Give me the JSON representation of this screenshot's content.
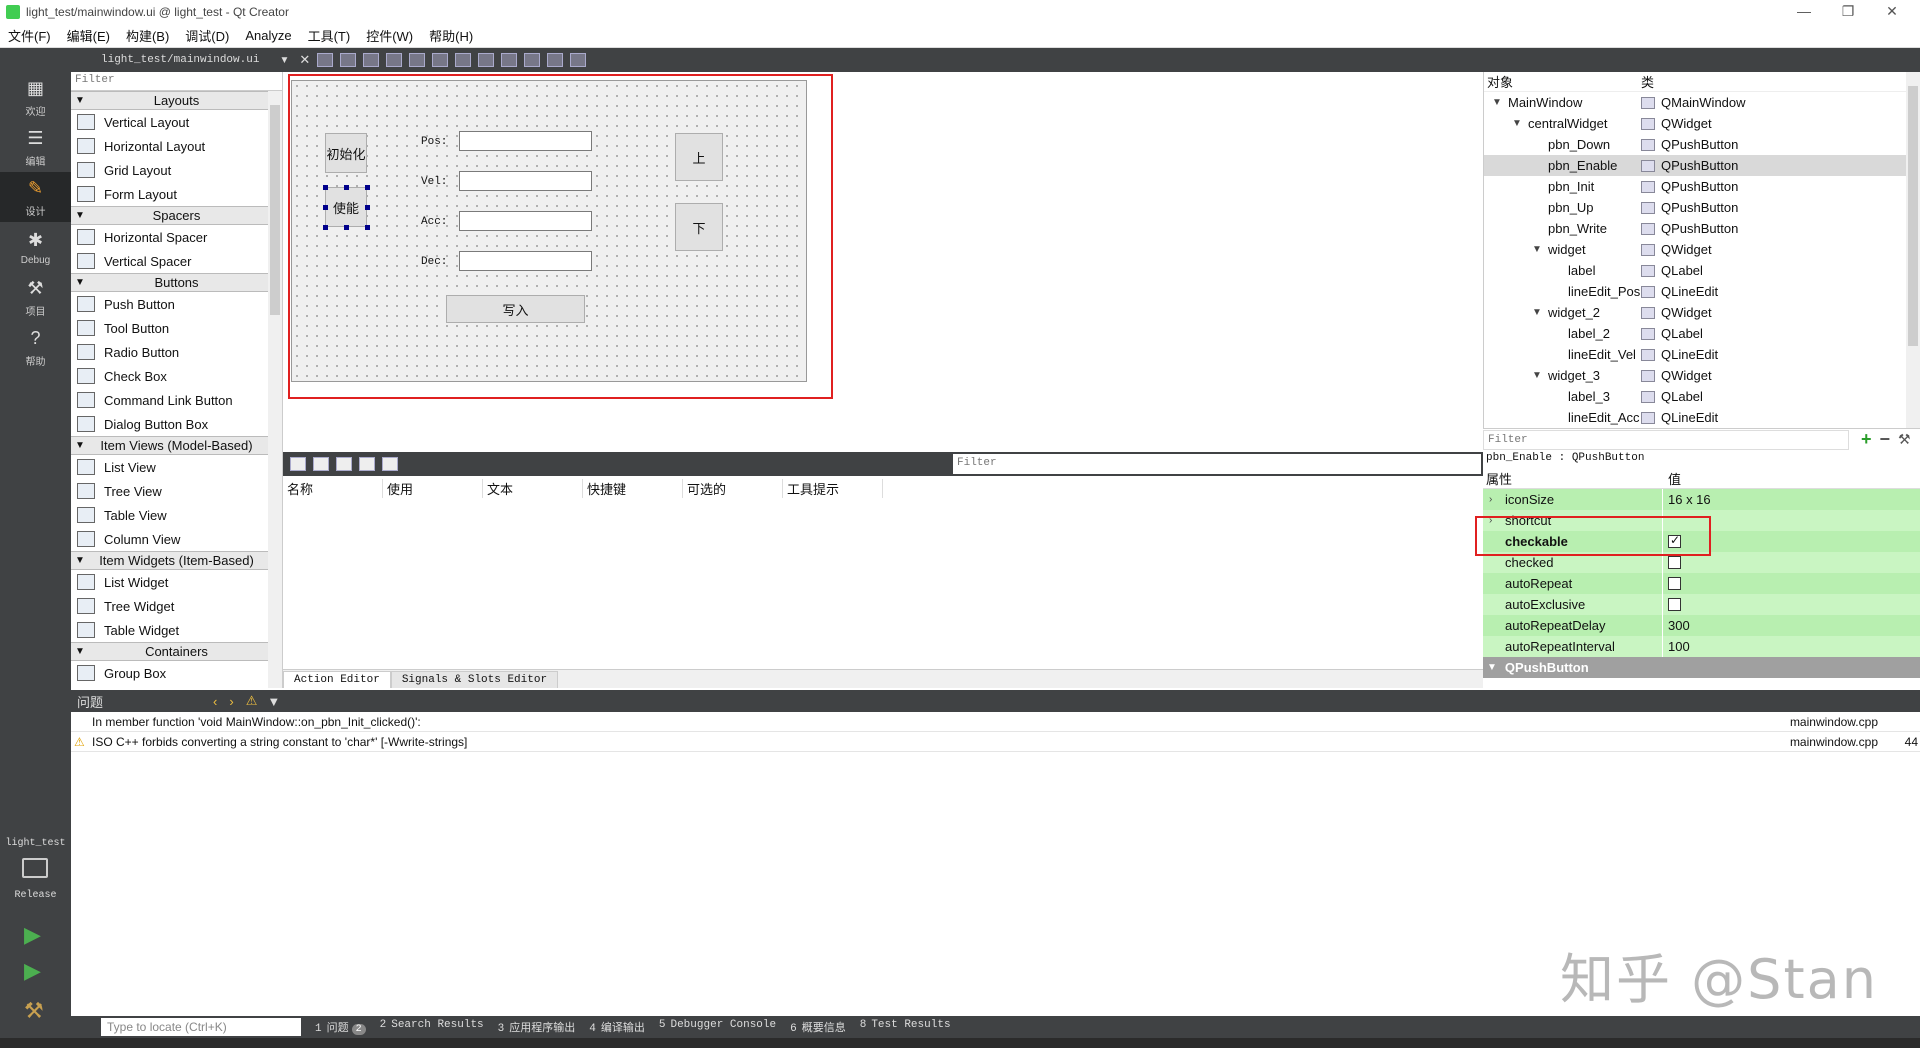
{
  "window": {
    "title": "light_test/mainwindow.ui @ light_test - Qt Creator"
  },
  "menu": [
    "文件(F)",
    "编辑(E)",
    "构建(B)",
    "调试(D)",
    "Analyze",
    "工具(T)",
    "控件(W)",
    "帮助(H)"
  ],
  "modes": [
    {
      "label": "欢迎",
      "icon": "grid-icon"
    },
    {
      "label": "编辑",
      "icon": "document-icon"
    },
    {
      "label": "设计",
      "icon": "pencil-icon"
    },
    {
      "label": "Debug",
      "icon": "bug-icon"
    },
    {
      "label": "项目",
      "icon": "wrench-icon"
    },
    {
      "label": "帮助",
      "icon": "help-icon"
    }
  ],
  "kit": {
    "project": "light_test",
    "config": "Release"
  },
  "toolbar": {
    "file": "light_test/mainwindow.ui"
  },
  "widgetbox": {
    "filter": "Filter",
    "sections": [
      {
        "title": "Layouts",
        "items": [
          "Vertical Layout",
          "Horizontal Layout",
          "Grid Layout",
          "Form Layout"
        ]
      },
      {
        "title": "Spacers",
        "items": [
          "Horizontal Spacer",
          "Vertical Spacer"
        ]
      },
      {
        "title": "Buttons",
        "items": [
          "Push Button",
          "Tool Button",
          "Radio Button",
          "Check Box",
          "Command Link Button",
          "Dialog Button Box"
        ]
      },
      {
        "title": "Item Views (Model-Based)",
        "items": [
          "List View",
          "Tree View",
          "Table View",
          "Column View"
        ]
      },
      {
        "title": "Item Widgets (Item-Based)",
        "items": [
          "List Widget",
          "Tree Widget",
          "Table Widget"
        ]
      },
      {
        "title": "Containers",
        "items": [
          "Group Box"
        ]
      }
    ]
  },
  "form": {
    "btn_init": "初始化",
    "btn_enable": "使能",
    "btn_up": "上",
    "btn_down": "下",
    "btn_write": "写入",
    "labels": [
      "Pos:",
      "Vel:",
      "Acc:",
      "Dec:"
    ]
  },
  "action_editor": {
    "filter": "Filter",
    "columns": [
      "名称",
      "使用",
      "文本",
      "快捷键",
      "可选的",
      "工具提示"
    ],
    "tabs": [
      "Action Editor",
      "Signals & Slots Editor"
    ]
  },
  "object_inspector": {
    "headers": [
      "对象",
      "类"
    ],
    "rows": [
      {
        "name": "MainWindow",
        "cls": "QMainWindow",
        "depth": 0,
        "exp": "v"
      },
      {
        "name": "centralWidget",
        "cls": "QWidget",
        "depth": 1,
        "exp": "v"
      },
      {
        "name": "pbn_Down",
        "cls": "QPushButton",
        "depth": 2,
        "exp": ""
      },
      {
        "name": "pbn_Enable",
        "cls": "QPushButton",
        "depth": 2,
        "exp": "",
        "selected": true
      },
      {
        "name": "pbn_Init",
        "cls": "QPushButton",
        "depth": 2,
        "exp": ""
      },
      {
        "name": "pbn_Up",
        "cls": "QPushButton",
        "depth": 2,
        "exp": ""
      },
      {
        "name": "pbn_Write",
        "cls": "QPushButton",
        "depth": 2,
        "exp": ""
      },
      {
        "name": "widget",
        "cls": "QWidget",
        "depth": 2,
        "exp": "v"
      },
      {
        "name": "label",
        "cls": "QLabel",
        "depth": 3,
        "exp": ""
      },
      {
        "name": "lineEdit_Pos",
        "cls": "QLineEdit",
        "depth": 3,
        "exp": ""
      },
      {
        "name": "widget_2",
        "cls": "QWidget",
        "depth": 2,
        "exp": "v"
      },
      {
        "name": "label_2",
        "cls": "QLabel",
        "depth": 3,
        "exp": ""
      },
      {
        "name": "lineEdit_Vel",
        "cls": "QLineEdit",
        "depth": 3,
        "exp": ""
      },
      {
        "name": "widget_3",
        "cls": "QWidget",
        "depth": 2,
        "exp": "v"
      },
      {
        "name": "label_3",
        "cls": "QLabel",
        "depth": 3,
        "exp": ""
      },
      {
        "name": "lineEdit_Acc",
        "cls": "QLineEdit",
        "depth": 3,
        "exp": ""
      }
    ]
  },
  "property_editor": {
    "filter": "Filter",
    "object_class": "pbn_Enable : QPushButton",
    "headers": [
      "属性",
      "值"
    ],
    "rows": [
      {
        "name": "iconSize",
        "value": "16 x 16",
        "expand": ">",
        "bold": false,
        "style": "g"
      },
      {
        "name": "shortcut",
        "value": "",
        "expand": ">",
        "bold": false,
        "style": "g2"
      },
      {
        "name": "checkable",
        "value": "",
        "checkbox": true,
        "checked": true,
        "bold": true,
        "style": "g"
      },
      {
        "name": "checked",
        "value": "",
        "checkbox": true,
        "checked": false,
        "bold": false,
        "style": "g2"
      },
      {
        "name": "autoRepeat",
        "value": "",
        "checkbox": true,
        "checked": false,
        "bold": false,
        "style": "g"
      },
      {
        "name": "autoExclusive",
        "value": "",
        "checkbox": true,
        "checked": false,
        "bold": false,
        "style": "g2"
      },
      {
        "name": "autoRepeatDelay",
        "value": "300",
        "bold": false,
        "style": "g"
      },
      {
        "name": "autoRepeatInterval",
        "value": "100",
        "bold": false,
        "style": "g2"
      }
    ],
    "section": "QPushButton"
  },
  "issues": {
    "title": "问题",
    "rows": [
      {
        "text": "In member function 'void MainWindow::on_pbn_Init_clicked()':",
        "file": "mainwindow.cpp",
        "line": "",
        "warn": false
      },
      {
        "text": "ISO C++ forbids converting a string constant to 'char*' [-Wwrite-strings]",
        "file": "mainwindow.cpp",
        "line": "44",
        "warn": true
      }
    ]
  },
  "watermark": "知乎 @Stan",
  "statusbar": {
    "locate_placeholder": "Type to locate (Ctrl+K)",
    "tabs": [
      {
        "num": "1",
        "label": "问题",
        "badge": "2"
      },
      {
        "num": "2",
        "label": "Search Results"
      },
      {
        "num": "3",
        "label": "应用程序输出"
      },
      {
        "num": "4",
        "label": "编译输出"
      },
      {
        "num": "5",
        "label": "Debugger Console"
      },
      {
        "num": "6",
        "label": "概要信息"
      },
      {
        "num": "8",
        "label": "Test Results"
      }
    ]
  }
}
